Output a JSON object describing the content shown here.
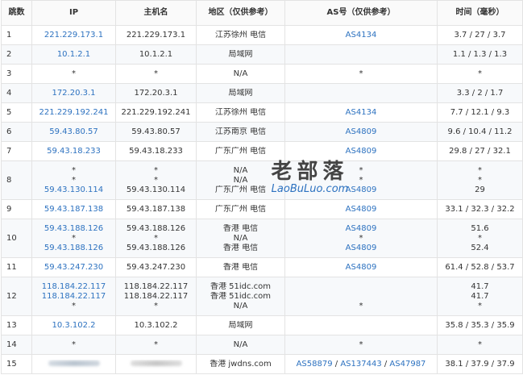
{
  "headers": {
    "hop": "跳数",
    "ip": "IP",
    "host": "主机名",
    "region": "地区（仅供参考）",
    "as": "AS号（仅供参考）",
    "time": "时间（毫秒）"
  },
  "rows": [
    {
      "hop": "1",
      "ip": [
        "221.229.173.1"
      ],
      "host": [
        "221.229.173.1"
      ],
      "region": [
        "江苏徐州 电信"
      ],
      "as": [
        "AS4134"
      ],
      "time": [
        "3.7 / 27 / 3.7"
      ]
    },
    {
      "hop": "2",
      "ip": [
        "10.1.2.1"
      ],
      "host": [
        "10.1.2.1"
      ],
      "region": [
        "局域网"
      ],
      "as": [
        ""
      ],
      "time": [
        "1.1 / 1.3 / 1.3"
      ]
    },
    {
      "hop": "3",
      "ip": [
        "*"
      ],
      "host": [
        "*"
      ],
      "region": [
        "N/A"
      ],
      "as": [
        "*"
      ],
      "time": [
        "*"
      ]
    },
    {
      "hop": "4",
      "ip": [
        "172.20.3.1"
      ],
      "host": [
        "172.20.3.1"
      ],
      "region": [
        "局域网"
      ],
      "as": [
        ""
      ],
      "time": [
        "3.3 / 2 / 1.7"
      ]
    },
    {
      "hop": "5",
      "ip": [
        "221.229.192.241"
      ],
      "host": [
        "221.229.192.241"
      ],
      "region": [
        "江苏徐州 电信"
      ],
      "as": [
        "AS4134"
      ],
      "time": [
        "7.7 / 12.1 / 9.3"
      ]
    },
    {
      "hop": "6",
      "ip": [
        "59.43.80.57"
      ],
      "host": [
        "59.43.80.57"
      ],
      "region": [
        "江苏南京 电信"
      ],
      "as": [
        "AS4809"
      ],
      "time": [
        "9.6 / 10.4 / 11.2"
      ]
    },
    {
      "hop": "7",
      "ip": [
        "59.43.18.233"
      ],
      "host": [
        "59.43.18.233"
      ],
      "region": [
        "广东广州 电信"
      ],
      "as": [
        "AS4809"
      ],
      "time": [
        "29.8 / 27 / 32.1"
      ]
    },
    {
      "hop": "8",
      "ip": [
        "*",
        "*",
        "59.43.130.114"
      ],
      "host": [
        "*",
        "*",
        "59.43.130.114"
      ],
      "region": [
        "N/A",
        "N/A",
        "广东广州 电信"
      ],
      "as": [
        "*",
        "*",
        "AS4809"
      ],
      "time": [
        "*",
        "*",
        "29"
      ]
    },
    {
      "hop": "9",
      "ip": [
        "59.43.187.138"
      ],
      "host": [
        "59.43.187.138"
      ],
      "region": [
        "广东广州 电信"
      ],
      "as": [
        "AS4809"
      ],
      "time": [
        "33.1 / 32.3 / 32.2"
      ]
    },
    {
      "hop": "10",
      "ip": [
        "59.43.188.126",
        "*",
        "59.43.188.126"
      ],
      "host": [
        "59.43.188.126",
        "*",
        "59.43.188.126"
      ],
      "region": [
        "香港 电信",
        "N/A",
        "香港 电信"
      ],
      "as": [
        "AS4809",
        "*",
        "AS4809"
      ],
      "time": [
        "51.6",
        "*",
        "52.4"
      ]
    },
    {
      "hop": "11",
      "ip": [
        "59.43.247.230"
      ],
      "host": [
        "59.43.247.230"
      ],
      "region": [
        "香港 电信"
      ],
      "as": [
        "AS4809"
      ],
      "time": [
        "61.4 / 52.8 / 53.7"
      ]
    },
    {
      "hop": "12",
      "ip": [
        "118.184.22.117",
        "118.184.22.117",
        "*"
      ],
      "host": [
        "118.184.22.117",
        "118.184.22.117",
        "*"
      ],
      "region": [
        "香港 51idc.com",
        "香港 51idc.com",
        "N/A"
      ],
      "as": [
        "",
        "",
        "*"
      ],
      "time": [
        "41.7",
        "41.7",
        "*"
      ]
    },
    {
      "hop": "13",
      "ip": [
        "10.3.102.2"
      ],
      "host": [
        "10.3.102.2"
      ],
      "region": [
        "局域网"
      ],
      "as": [
        ""
      ],
      "time": [
        "35.8 / 35.3 / 35.9"
      ]
    },
    {
      "hop": "14",
      "ip": [
        "*"
      ],
      "host": [
        "*"
      ],
      "region": [
        "N/A"
      ],
      "as": [
        "*"
      ],
      "time": [
        "*"
      ]
    },
    {
      "hop": "15",
      "ip": [
        "__blur__"
      ],
      "host": [
        "__blur__"
      ],
      "region": [
        "香港 jwdns.com"
      ],
      "as": [
        "AS58879 / AS137443 / AS47987"
      ],
      "time": [
        "38.1 / 37.9 / 37.9"
      ]
    }
  ],
  "row15_as": [
    "AS58879",
    "AS137443",
    "AS47987"
  ],
  "watermark": {
    "cn": "老部落",
    "en": "LaoBuLuo.com"
  },
  "colors": {
    "link": "#2d72c0",
    "border": "#e3e3e3",
    "stripe": "#f7f9fb"
  }
}
